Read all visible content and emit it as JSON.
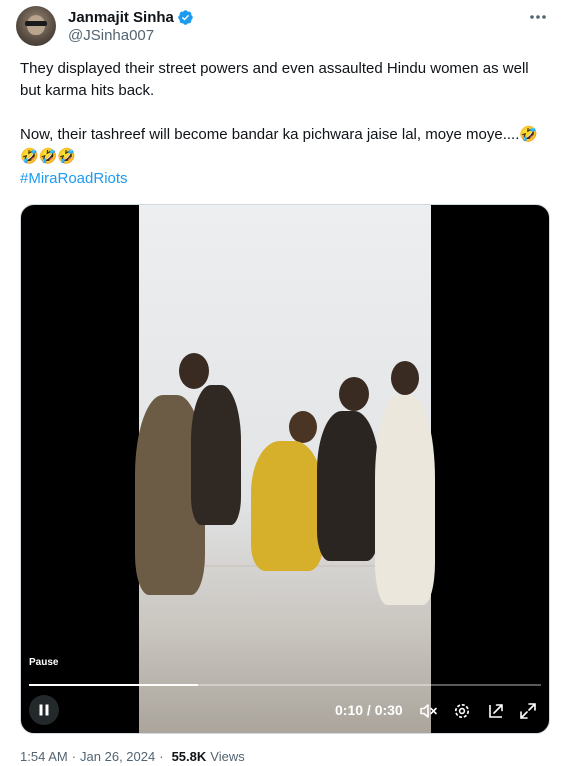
{
  "author": {
    "display_name": "Janmajit Sinha",
    "handle": "@JSinha007",
    "verified": true,
    "accent": "#1d9bf0"
  },
  "tweet": {
    "line1": "They displayed their street powers and even assaulted Hindu women as well but karma hits back.",
    "line2": "Now, their tashreef will become bandar ka pichwara jaise lal, moye moye....🤣🤣🤣🤣",
    "hashtag": "#MiraRoadRiots"
  },
  "video": {
    "pause_tooltip": "Pause",
    "time_display": "0:10 / 0:30",
    "progress_fraction": 0.33,
    "icons": [
      "pause-icon",
      "mute-icon",
      "settings-icon",
      "pop-out-icon",
      "fullscreen-icon"
    ]
  },
  "meta": {
    "time": "1:54 AM",
    "sep1": "·",
    "date": "Jan 26, 2024",
    "sep2": "·",
    "views_count": "55.8K",
    "views_label": "Views"
  }
}
